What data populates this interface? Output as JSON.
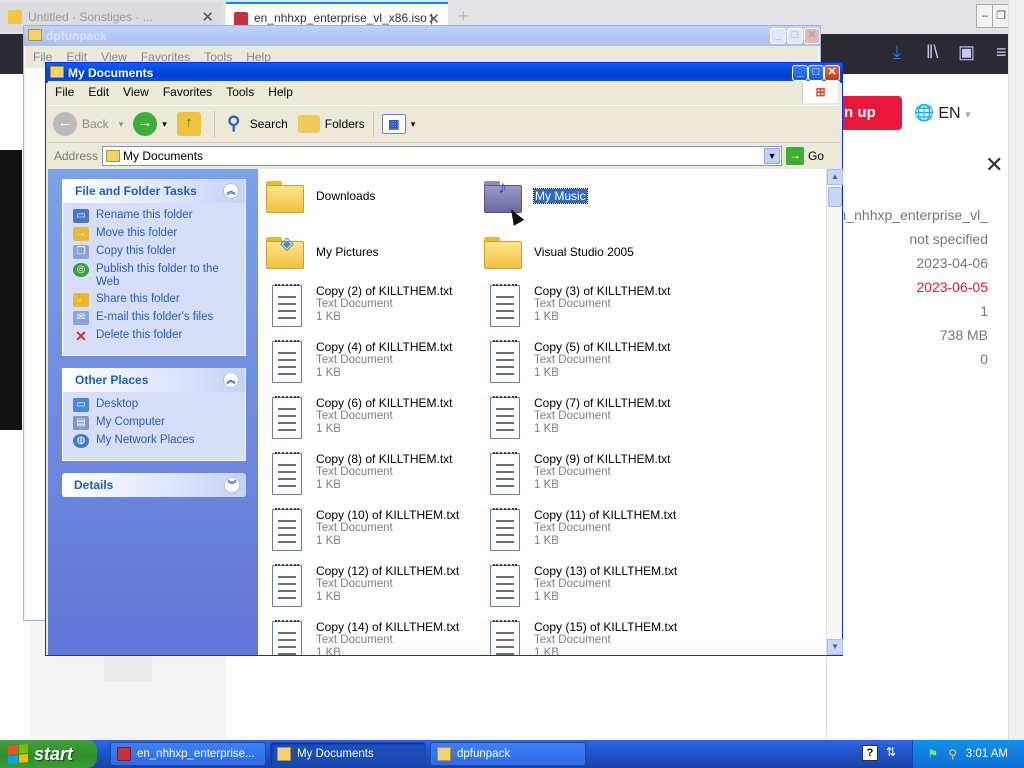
{
  "browser": {
    "tabs": [
      {
        "label": "Untitled · Sonstiges · ...",
        "active": false
      },
      {
        "label": "en_nhhxp_enterprise_vl_x86.iso |",
        "active": true
      }
    ],
    "signup_label": "n up",
    "language": "EN",
    "details_values": [
      {
        "value": "en_nhhxp_enterprise_vl_",
        "highlight": false
      },
      {
        "value": "not specified",
        "highlight": false
      },
      {
        "value": "2023-04-06",
        "highlight": false
      },
      {
        "value": "2023-06-05",
        "highlight": true
      },
      {
        "value": "1",
        "highlight": false
      },
      {
        "value": "738 MB",
        "highlight": false
      },
      {
        "value": "0",
        "highlight": false
      }
    ],
    "accent_red": "#e8173c"
  },
  "dpfun": {
    "title": "dpfunpack",
    "menu": [
      "File",
      "Edit",
      "View",
      "Favorites",
      "Tools",
      "Help"
    ]
  },
  "mydocs": {
    "title": "My Documents",
    "menu": [
      "File",
      "Edit",
      "View",
      "Favorites",
      "Tools",
      "Help"
    ],
    "toolbar": {
      "back_label": "Back",
      "search_label": "Search",
      "folders_label": "Folders"
    },
    "address": {
      "label": "Address",
      "value": "My Documents",
      "go_label": "Go"
    },
    "tasks": {
      "file_folder": {
        "title": "File and Folder Tasks",
        "items": [
          "Rename this folder",
          "Move this folder",
          "Copy this folder",
          "Publish this folder to the Web",
          "Share this folder",
          "E-mail this folder's files",
          "Delete this folder"
        ]
      },
      "other_places": {
        "title": "Other Places",
        "items": [
          "Desktop",
          "My Computer",
          "My Network Places"
        ]
      },
      "details": {
        "title": "Details"
      }
    },
    "folders": [
      {
        "name": "Downloads",
        "icon": "folder-icon",
        "selected": false
      },
      {
        "name": "My Music",
        "icon": "music-folder-icon",
        "selected": true
      },
      {
        "name": "My Pictures",
        "icon": "pictures-folder-icon",
        "selected": false
      },
      {
        "name": "Visual Studio 2005",
        "icon": "folder-icon",
        "selected": false
      }
    ],
    "files": [
      {
        "name": "Copy (2) of KILLTHEM.txt",
        "type": "Text Document",
        "size": "1 KB"
      },
      {
        "name": "Copy (3) of KILLTHEM.txt",
        "type": "Text Document",
        "size": "1 KB"
      },
      {
        "name": "Copy (4) of KILLTHEM.txt",
        "type": "Text Document",
        "size": "1 KB"
      },
      {
        "name": "Copy (5) of KILLTHEM.txt",
        "type": "Text Document",
        "size": "1 KB"
      },
      {
        "name": "Copy (6) of KILLTHEM.txt",
        "type": "Text Document",
        "size": "1 KB"
      },
      {
        "name": "Copy (7) of KILLTHEM.txt",
        "type": "Text Document",
        "size": "1 KB"
      },
      {
        "name": "Copy (8) of KILLTHEM.txt",
        "type": "Text Document",
        "size": "1 KB"
      },
      {
        "name": "Copy (9) of KILLTHEM.txt",
        "type": "Text Document",
        "size": "1 KB"
      },
      {
        "name": "Copy (10) of KILLTHEM.txt",
        "type": "Text Document",
        "size": "1 KB"
      },
      {
        "name": "Copy (11) of KILLTHEM.txt",
        "type": "Text Document",
        "size": "1 KB"
      },
      {
        "name": "Copy (12) of KILLTHEM.txt",
        "type": "Text Document",
        "size": "1 KB"
      },
      {
        "name": "Copy (13) of KILLTHEM.txt",
        "type": "Text Document",
        "size": "1 KB"
      },
      {
        "name": "Copy (14) of KILLTHEM.txt",
        "type": "Text Document",
        "size": "1 KB"
      },
      {
        "name": "Copy (15) of KILLTHEM.txt",
        "type": "Text Document",
        "size": "1 KB"
      }
    ]
  },
  "taskbar": {
    "start_label": "start",
    "buttons": [
      {
        "label": "en_nhhxp_enterprise...",
        "active": false
      },
      {
        "label": "My Documents",
        "active": true
      },
      {
        "label": "dpfunpack",
        "active": false
      }
    ],
    "clock": "3:01 AM"
  }
}
